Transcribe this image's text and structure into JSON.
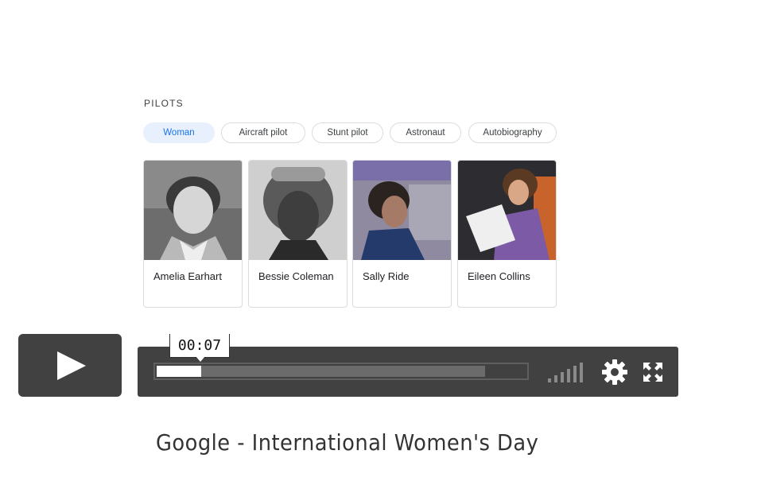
{
  "section": {
    "heading": "PILOTS"
  },
  "chips": [
    {
      "label": "Woman",
      "active": true
    },
    {
      "label": "Aircraft pilot",
      "active": false
    },
    {
      "label": "Stunt pilot",
      "active": false
    },
    {
      "label": "Astronaut",
      "active": false
    },
    {
      "label": "Autobiography",
      "active": false
    }
  ],
  "cards": [
    {
      "name": "Amelia Earhart"
    },
    {
      "name": "Bessie Coleman"
    },
    {
      "name": "Sally Ride"
    },
    {
      "name": "Eileen Collins"
    }
  ],
  "player": {
    "current_time": "00:07",
    "played_fraction": 0.12,
    "buffered_fraction": 0.89,
    "controls_bg": "#414141",
    "icons": [
      "play-icon",
      "volume-icon",
      "gear-icon",
      "fullscreen-icon"
    ]
  },
  "video": {
    "title": "Google - International Women's Day"
  }
}
